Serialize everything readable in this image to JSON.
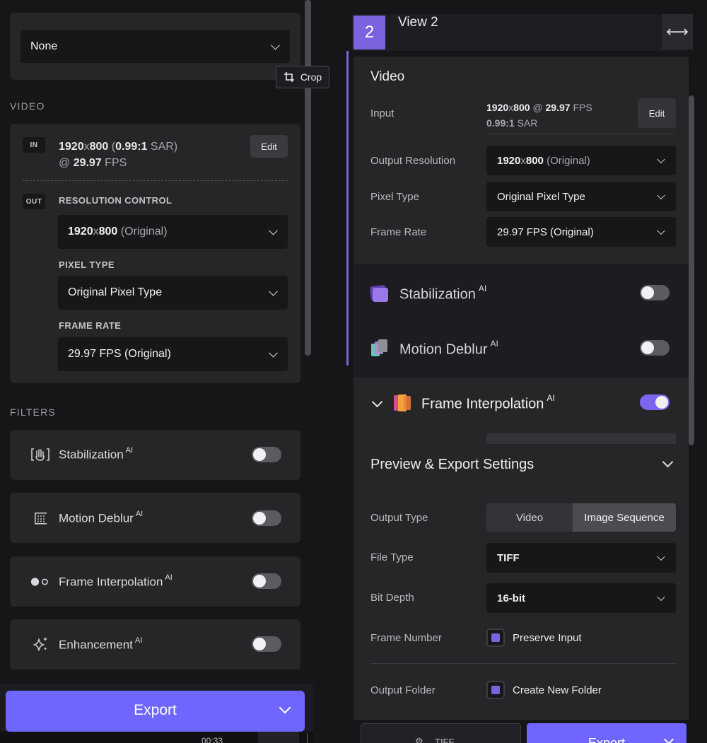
{
  "left": {
    "preset_dropdown": {
      "value": "None"
    },
    "video_section": {
      "heading": "VIDEO",
      "in_tag": "IN",
      "input_res": "1920",
      "input_x": "x",
      "input_res2": "800",
      "input_sar_open": " (",
      "input_sar": "0.99:1",
      "input_sar_unit": " SAR)",
      "input_fps_at": "@ ",
      "input_fps": "29.97",
      "input_fps_unit": " FPS",
      "edit_label": "Edit",
      "out_tag": "OUT",
      "resolution_label": "RESOLUTION CONTROL",
      "resolution_a": "1920",
      "resolution_x": "x",
      "resolution_b": "800",
      "resolution_suffix": " (Original)",
      "pixel_type_label": "PIXEL TYPE",
      "pixel_type_value": "Original Pixel Type",
      "frame_rate_label": "FRAME RATE",
      "frame_rate_value": "29.97 FPS (Original)"
    },
    "filters_section": {
      "heading": "FILTERS",
      "ai_badge": "AI",
      "items": [
        {
          "label": "Stabilization",
          "icon": "stabilization-icon",
          "enabled": false
        },
        {
          "label": "Motion Deblur",
          "icon": "motion-deblur-icon",
          "enabled": false
        },
        {
          "label": "Frame Interpolation",
          "icon": "frame-interpolation-icon",
          "enabled": false
        },
        {
          "label": "Enhancement",
          "icon": "sparkle-icon",
          "enabled": false
        }
      ]
    },
    "export_button": {
      "label": "Export"
    },
    "timeline_time": "00:33"
  },
  "right": {
    "view": {
      "number": "2",
      "name": "View 2",
      "expand_glyph": "⟷"
    },
    "video": {
      "title": "Video",
      "crop_label": "Crop",
      "input_label": "Input",
      "input_res": "1920",
      "input_x": "x",
      "input_res2": "800",
      "input_fps_at": " @ ",
      "input_fps": "29.97",
      "input_fps_unit": " FPS",
      "input_sar": "0.99:1",
      "input_sar_unit": " SAR",
      "edit_label": "Edit",
      "output_resolution_label": "Output Resolution",
      "output_res_a": "1920",
      "output_res_x": "x",
      "output_res_b": "800",
      "output_res_suffix": " (Original)",
      "pixel_type_label": "Pixel Type",
      "pixel_type_value": "Original Pixel Type",
      "frame_rate_label": "Frame Rate",
      "frame_rate_value": "29.97 FPS (Original)"
    },
    "filters": {
      "ai_badge": "AI",
      "items": [
        {
          "label": "Stabilization",
          "enabled": false
        },
        {
          "label": "Motion Deblur",
          "enabled": false
        },
        {
          "label": "Frame Interpolation",
          "enabled": true
        }
      ]
    },
    "preview_export": {
      "title": "Preview & Export Settings",
      "output_type_label": "Output Type",
      "output_type_options": [
        "Video",
        "Image Sequence"
      ],
      "output_type_selected": "Image Sequence",
      "file_type_label": "File Type",
      "file_type_value": "TIFF",
      "bit_depth_label": "Bit Depth",
      "bit_depth_value": "16-bit",
      "frame_number_label": "Frame Number",
      "frame_number_option": "Preserve Input",
      "output_folder_label": "Output Folder",
      "output_folder_option": "Create New Folder"
    },
    "bottom_bar": {
      "format_label": "TIFF",
      "export_label": "Export"
    }
  },
  "colors": {
    "accent": "#7b63e0",
    "export_button": "#6e66ff",
    "panel": "#262629",
    "background": "#161619"
  }
}
